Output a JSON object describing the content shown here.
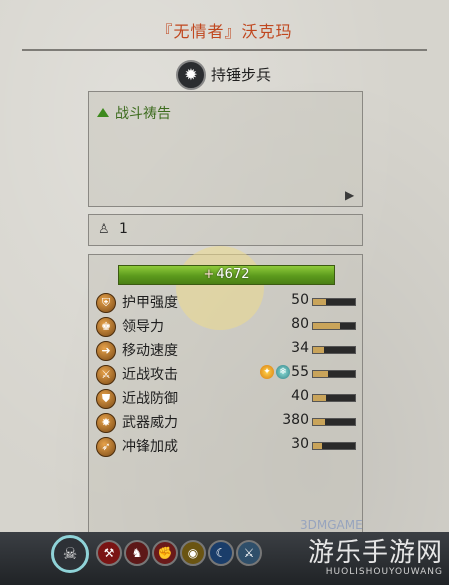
{
  "unit": {
    "title": "『无情者』沃克玛",
    "type": "持锤步兵",
    "type_icon": "star-burst-icon"
  },
  "ability": {
    "name": "战斗祷告",
    "icon": "triangle-up-icon"
  },
  "unit_count": "1",
  "health": {
    "value": "4672",
    "plus": "+"
  },
  "stats": [
    {
      "label": "护甲强度",
      "value": "50",
      "icon": "armor-icon",
      "bar_fraction": 0.3
    },
    {
      "label": "领导力",
      "value": "80",
      "icon": "leadership-icon",
      "bar_fraction": 0.65
    },
    {
      "label": "移动速度",
      "value": "34",
      "icon": "speed-icon",
      "bar_fraction": 0.25
    },
    {
      "label": "近战攻击",
      "value": "55",
      "icon": "melee-attack-icon",
      "bar_fraction": 0.35
    },
    {
      "label": "近战防御",
      "value": "40",
      "icon": "melee-defence-icon",
      "bar_fraction": 0.3
    },
    {
      "label": "武器威力",
      "value": "380",
      "icon": "weapon-strength-icon",
      "bar_fraction": 0.28
    },
    {
      "label": "冲锋加成",
      "value": "30",
      "icon": "charge-bonus-icon",
      "bar_fraction": 0.22
    }
  ],
  "watermark": {
    "main": "游乐手游网",
    "sub": "HUOLISHOUYOUWANG",
    "game": "3DMGAME"
  },
  "colors": {
    "title": "#c0471f",
    "ability": "#3d6c1e",
    "health_bar": "#6aab24",
    "parchment": "#d6d4cd"
  }
}
